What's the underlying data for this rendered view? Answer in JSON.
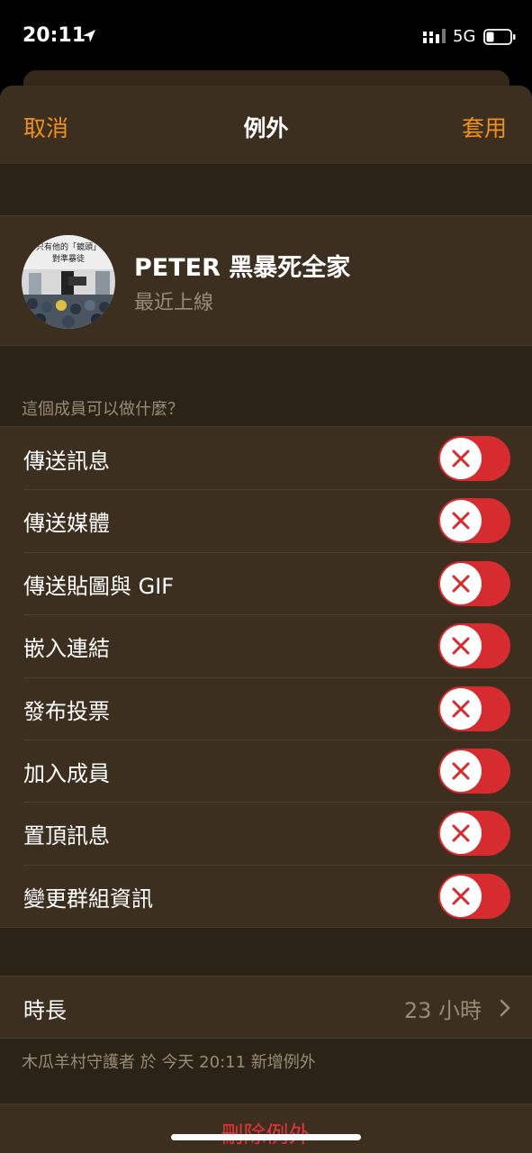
{
  "status_bar": {
    "time": "20:11",
    "network": "5G",
    "battery_level": 0.3
  },
  "navbar": {
    "cancel": "取消",
    "title": "例外",
    "apply": "套用"
  },
  "profile": {
    "name": "PETER 黑暴死全家",
    "status": "最近上線",
    "avatar_caption": "只有他的「鏡頭」對準暴徒"
  },
  "permissions": {
    "header": "這個成員可以做什麼？",
    "items": [
      {
        "label": "傳送訊息",
        "enabled": false
      },
      {
        "label": "傳送媒體",
        "enabled": false
      },
      {
        "label": "傳送貼圖與 GIF",
        "enabled": false
      },
      {
        "label": "嵌入連結",
        "enabled": false
      },
      {
        "label": "發布投票",
        "enabled": false
      },
      {
        "label": "加入成員",
        "enabled": false
      },
      {
        "label": "置頂訊息",
        "enabled": false
      },
      {
        "label": "變更群組資訊",
        "enabled": false
      }
    ]
  },
  "duration": {
    "label": "時長",
    "value": "23 小時"
  },
  "footnote": "木瓜羊村守護者 於 今天 20:11 新增例外",
  "delete": "刪除例外",
  "colors": {
    "accent": "#f0901e",
    "destructive": "#e0343a",
    "toggle_off": "#d62b2f",
    "background": "#2c2317",
    "cell": "#3d2f1f"
  }
}
